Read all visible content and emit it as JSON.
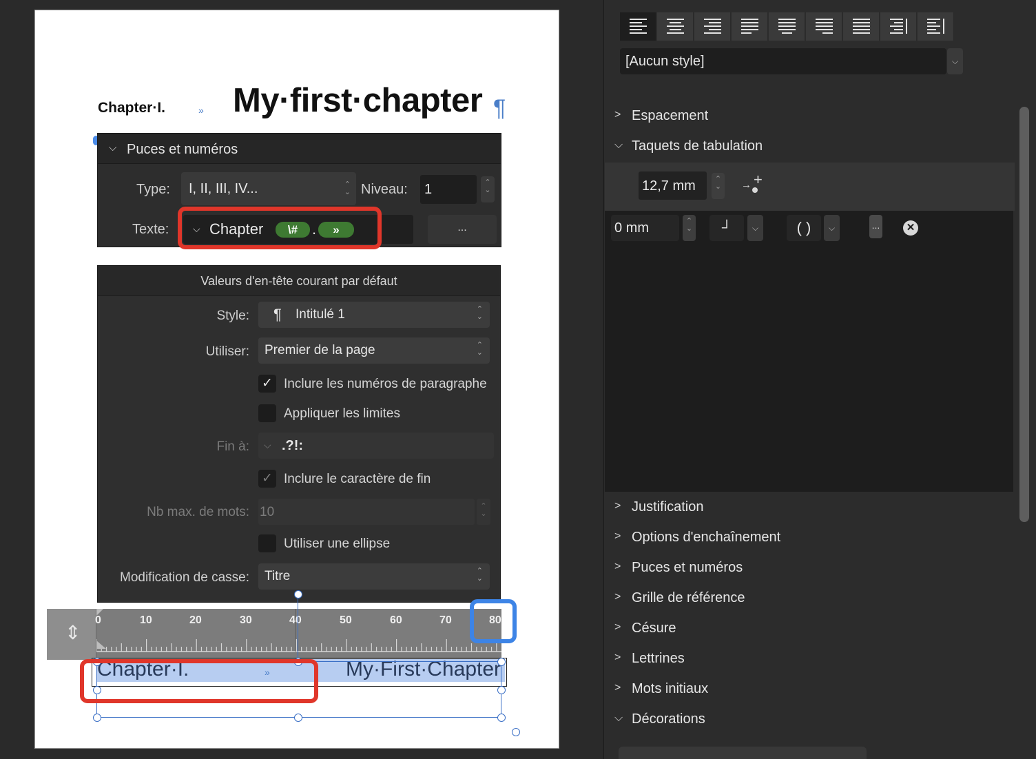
{
  "page": {
    "heading": {
      "chapter_label": "Chapter·I.",
      "tab_marker": "»",
      "title": "My·first·chapter",
      "pilcrow": "¶"
    },
    "header_line": {
      "chapter_label": "Chapter·I.",
      "tab_marker": "»",
      "title": "My·First·Chapter"
    }
  },
  "bullets_panel": {
    "title": "Puces et numéros",
    "type_label": "Type:",
    "type_value": "I, II, III, IV...",
    "level_label": "Niveau:",
    "level_value": "1",
    "text_label": "Texte:",
    "text_prefix": "Chapter",
    "token_number": "\\#",
    "token_separator": ".",
    "token_tab": "»",
    "more_button": "..."
  },
  "header_panel": {
    "title": "Valeurs d'en-tête courant par défaut",
    "style_label": "Style:",
    "style_value": "Intitulé 1",
    "style_icon": "¶",
    "use_label": "Utiliser:",
    "use_value": "Premier de la page",
    "include_numbers": {
      "label": "Inclure les numéros de paragraphe",
      "checked": true
    },
    "apply_limits": {
      "label": "Appliquer les limites",
      "checked": false
    },
    "end_label": "Fin à:",
    "end_value": ".?!:",
    "include_end_char": {
      "label": "Inclure le caractère de fin",
      "checked": true
    },
    "max_words_label": "Nb max. de mots:",
    "max_words_value": "10",
    "use_ellipsis": {
      "label": "Utiliser une ellipse",
      "checked": false
    },
    "case_label": "Modification de casse:",
    "case_value": "Titre"
  },
  "ruler": {
    "marks": [
      "10",
      "20",
      "30",
      "40",
      "50",
      "60",
      "70",
      "80"
    ],
    "leading_mark": "0"
  },
  "inspector": {
    "alignment_buttons": [
      "align-left",
      "align-center",
      "align-right",
      "justify-left",
      "justify-center",
      "justify-right",
      "justify-all",
      "align-toward-spine",
      "align-away-from-spine"
    ],
    "paragraph_style": "[Aucun style]",
    "sections": {
      "spacing": "Espacement",
      "tab_stops": "Taquets de tabulation",
      "justification": "Justification",
      "flow_options": "Options d'enchaînement",
      "bullets": "Puces et numéros",
      "baseline_grid": "Grille de référence",
      "hyphenation": "Césure",
      "drop_caps": "Lettrines",
      "initial_words": "Mots initiaux",
      "decorations": "Décorations"
    },
    "default_tab": "12,7 mm",
    "tab_position": "0 mm",
    "tab_align_glyph": "┘",
    "tab_leader_glyph": "( )",
    "tab_more": "..."
  },
  "colors": {
    "highlight_red": "#e0362a",
    "highlight_blue": "#3d84e6",
    "token_green": "#3e7a32",
    "selection_blue": "#b7cdf1"
  }
}
